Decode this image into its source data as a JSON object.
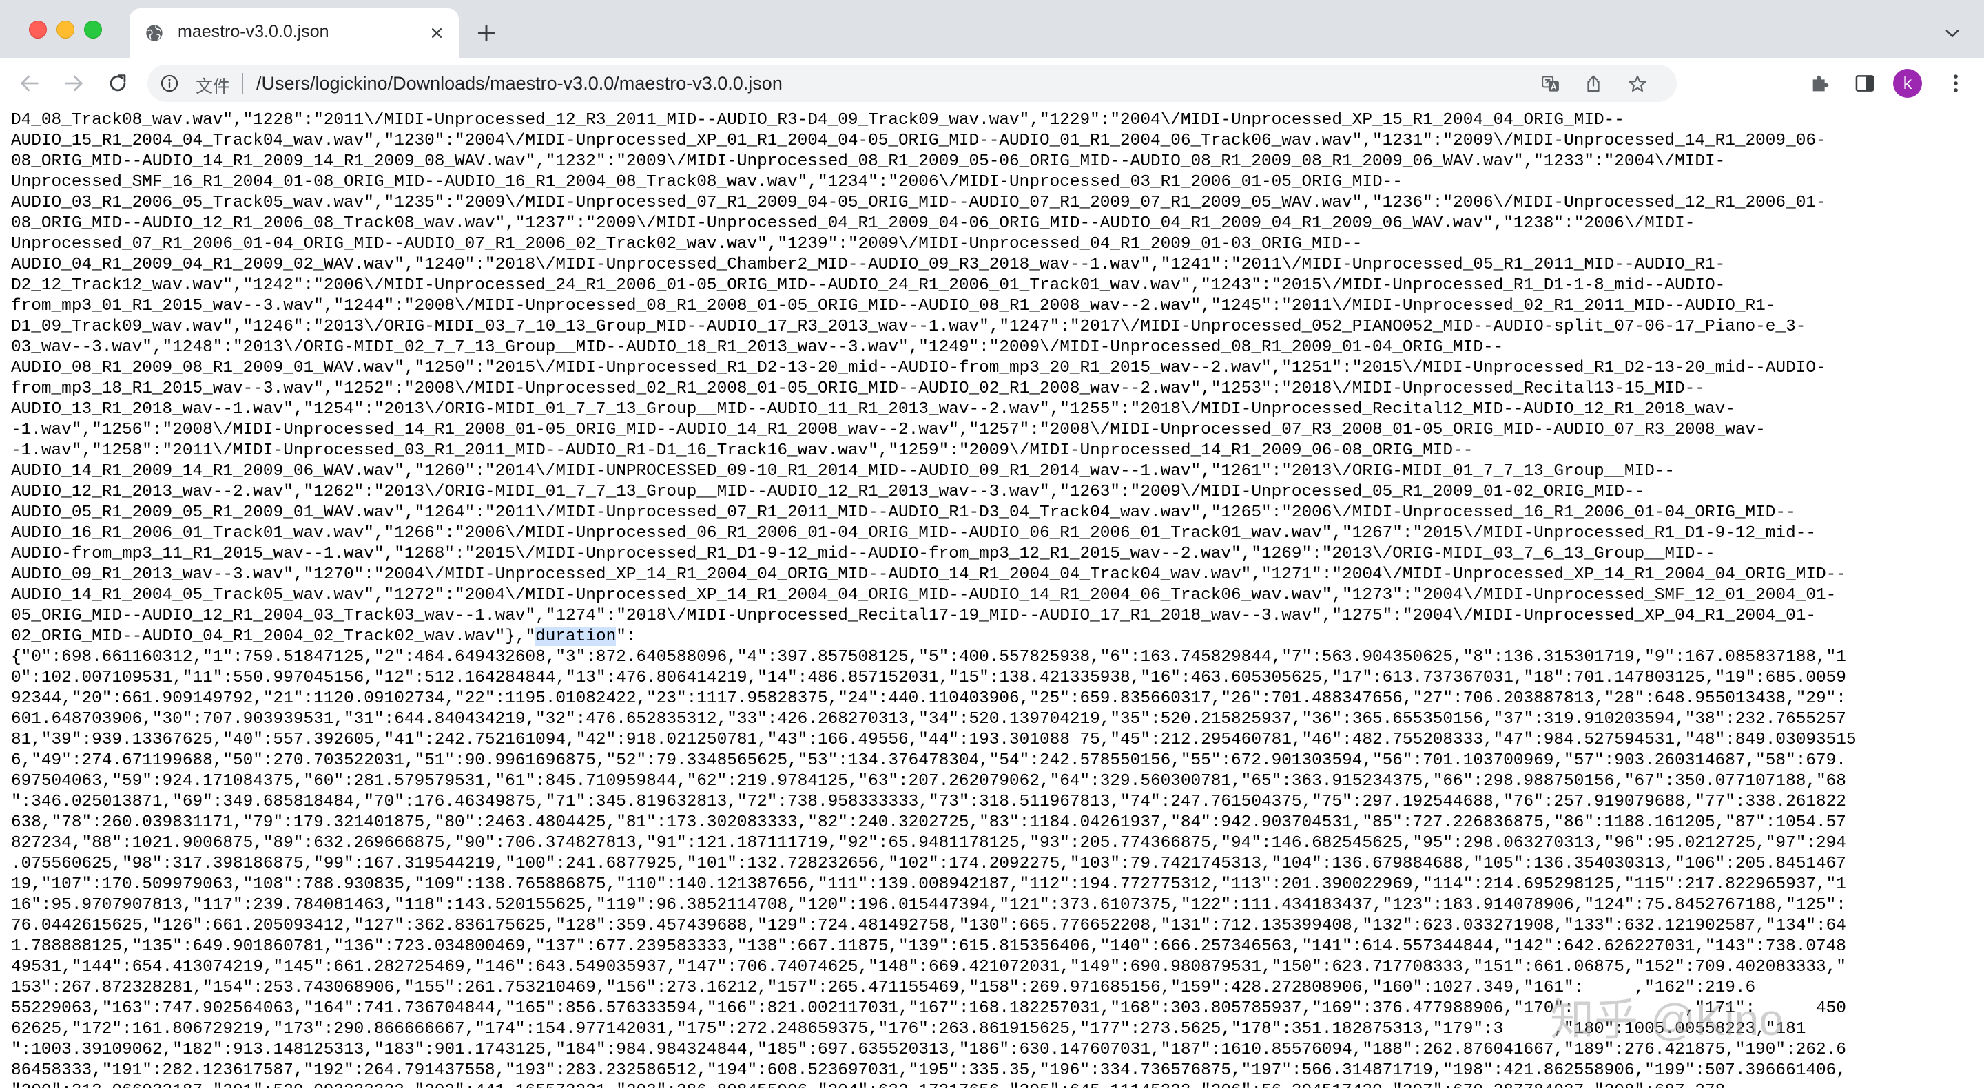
{
  "browser": {
    "tab": {
      "title": "maestro-v3.0.0.json",
      "favicon": "globe-icon"
    },
    "omnibox": {
      "scheme_label": "文件",
      "url": "/Users/logickino/Downloads/maestro-v3.0.0/maestro-v3.0.0.json"
    },
    "profile_initial": "k",
    "colors": {
      "titlebar": "#dee1e6",
      "omnibox": "#f1f3f4",
      "avatar": "#9c27b0",
      "highlight": "#cfe3fc"
    }
  },
  "content": {
    "lines_before": [
      "D4_08_Track08_wav.wav\",\"1228\":\"2011\\/MIDI-Unprocessed_12_R3_2011_MID--AUDIO_R3-D4_09_Track09_wav.wav\",\"1229\":\"2004\\/MIDI-Unprocessed_XP_15_R1_2004_04_ORIG_MID--",
      "AUDIO_15_R1_2004_04_Track04_wav.wav\",\"1230\":\"2004\\/MIDI-Unprocessed_XP_01_R1_2004_04-05_ORIG_MID--AUDIO_01_R1_2004_06_Track06_wav.wav\",\"1231\":\"2009\\/MIDI-Unprocessed_14_R1_2009_06-",
      "08_ORIG_MID--AUDIO_14_R1_2009_14_R1_2009_08_WAV.wav\",\"1232\":\"2009\\/MIDI-Unprocessed_08_R1_2009_05-06_ORIG_MID--AUDIO_08_R1_2009_08_R1_2009_06_WAV.wav\",\"1233\":\"2004\\/MIDI-",
      "Unprocessed_SMF_16_R1_2004_01-08_ORIG_MID--AUDIO_16_R1_2004_08_Track08_wav.wav\",\"1234\":\"2006\\/MIDI-Unprocessed_03_R1_2006_01-05_ORIG_MID--",
      "AUDIO_03_R1_2006_05_Track05_wav.wav\",\"1235\":\"2009\\/MIDI-Unprocessed_07_R1_2009_04-05_ORIG_MID--AUDIO_07_R1_2009_07_R1_2009_05_WAV.wav\",\"1236\":\"2006\\/MIDI-Unprocessed_12_R1_2006_01-",
      "08_ORIG_MID--AUDIO_12_R1_2006_08_Track08_wav.wav\",\"1237\":\"2009\\/MIDI-Unprocessed_04_R1_2009_04-06_ORIG_MID--AUDIO_04_R1_2009_04_R1_2009_06_WAV.wav\",\"1238\":\"2006\\/MIDI-",
      "Unprocessed_07_R1_2006_01-04_ORIG_MID--AUDIO_07_R1_2006_02_Track02_wav.wav\",\"1239\":\"2009\\/MIDI-Unprocessed_04_R1_2009_01-03_ORIG_MID--",
      "AUDIO_04_R1_2009_04_R1_2009_02_WAV.wav\",\"1240\":\"2018\\/MIDI-Unprocessed_Chamber2_MID--AUDIO_09_R3_2018_wav--1.wav\",\"1241\":\"2011\\/MIDI-Unprocessed_05_R1_2011_MID--AUDIO_R1-",
      "D2_12_Track12_wav.wav\",\"1242\":\"2006\\/MIDI-Unprocessed_24_R1_2006_01-05_ORIG_MID--AUDIO_24_R1_2006_01_Track01_wav.wav\",\"1243\":\"2015\\/MIDI-Unprocessed_R1_D1-1-8_mid--AUDIO-",
      "from_mp3_01_R1_2015_wav--3.wav\",\"1244\":\"2008\\/MIDI-Unprocessed_08_R1_2008_01-05_ORIG_MID--AUDIO_08_R1_2008_wav--2.wav\",\"1245\":\"2011\\/MIDI-Unprocessed_02_R1_2011_MID--AUDIO_R1-",
      "D1_09_Track09_wav.wav\",\"1246\":\"2013\\/ORIG-MIDI_03_7_10_13_Group_MID--AUDIO_17_R3_2013_wav--1.wav\",\"1247\":\"2017\\/MIDI-Unprocessed_052_PIANO052_MID--AUDIO-split_07-06-17_Piano-e_3-",
      "03_wav--3.wav\",\"1248\":\"2013\\/ORIG-MIDI_02_7_7_13_Group__MID--AUDIO_18_R1_2013_wav--3.wav\",\"1249\":\"2009\\/MIDI-Unprocessed_08_R1_2009_01-04_ORIG_MID--",
      "AUDIO_08_R1_2009_08_R1_2009_01_WAV.wav\",\"1250\":\"2015\\/MIDI-Unprocessed_R1_D2-13-20_mid--AUDIO-from_mp3_20_R1_2015_wav--2.wav\",\"1251\":\"2015\\/MIDI-Unprocessed_R1_D2-13-20_mid--AUDIO-",
      "from_mp3_18_R1_2015_wav--3.wav\",\"1252\":\"2008\\/MIDI-Unprocessed_02_R1_2008_01-05_ORIG_MID--AUDIO_02_R1_2008_wav--2.wav\",\"1253\":\"2018\\/MIDI-Unprocessed_Recital13-15_MID--",
      "AUDIO_13_R1_2018_wav--1.wav\",\"1254\":\"2013\\/ORIG-MIDI_01_7_7_13_Group__MID--AUDIO_11_R1_2013_wav--2.wav\",\"1255\":\"2018\\/MIDI-Unprocessed_Recital12_MID--AUDIO_12_R1_2018_wav-",
      "-1.wav\",\"1256\":\"2008\\/MIDI-Unprocessed_14_R1_2008_01-05_ORIG_MID--AUDIO_14_R1_2008_wav--2.wav\",\"1257\":\"2008\\/MIDI-Unprocessed_07_R3_2008_01-05_ORIG_MID--AUDIO_07_R3_2008_wav-",
      "-1.wav\",\"1258\":\"2011\\/MIDI-Unprocessed_03_R1_2011_MID--AUDIO_R1-D1_16_Track16_wav.wav\",\"1259\":\"2009\\/MIDI-Unprocessed_14_R1_2009_06-08_ORIG_MID--",
      "AUDIO_14_R1_2009_14_R1_2009_06_WAV.wav\",\"1260\":\"2014\\/MIDI-UNPROCESSED_09-10_R1_2014_MID--AUDIO_09_R1_2014_wav--1.wav\",\"1261\":\"2013\\/ORIG-MIDI_01_7_7_13_Group__MID--",
      "AUDIO_12_R1_2013_wav--2.wav\",\"1262\":\"2013\\/ORIG-MIDI_01_7_7_13_Group__MID--AUDIO_12_R1_2013_wav--3.wav\",\"1263\":\"2009\\/MIDI-Unprocessed_05_R1_2009_01-02_ORIG_MID--",
      "AUDIO_05_R1_2009_05_R1_2009_01_WAV.wav\",\"1264\":\"2011\\/MIDI-Unprocessed_07_R1_2011_MID--AUDIO_R1-D3_04_Track04_wav.wav\",\"1265\":\"2006\\/MIDI-Unprocessed_16_R1_2006_01-04_ORIG_MID--",
      "AUDIO_16_R1_2006_01_Track01_wav.wav\",\"1266\":\"2006\\/MIDI-Unprocessed_06_R1_2006_01-04_ORIG_MID--AUDIO_06_R1_2006_01_Track01_wav.wav\",\"1267\":\"2015\\/MIDI-Unprocessed_R1_D1-9-12_mid--",
      "AUDIO-from_mp3_11_R1_2015_wav--1.wav\",\"1268\":\"2015\\/MIDI-Unprocessed_R1_D1-9-12_mid--AUDIO-from_mp3_12_R1_2015_wav--2.wav\",\"1269\":\"2013\\/ORIG-MIDI_03_7_6_13_Group__MID--",
      "AUDIO_09_R1_2013_wav--3.wav\",\"1270\":\"2004\\/MIDI-Unprocessed_XP_14_R1_2004_04_ORIG_MID--AUDIO_14_R1_2004_04_Track04_wav.wav\",\"1271\":\"2004\\/MIDI-Unprocessed_XP_14_R1_2004_04_ORIG_MID--",
      "AUDIO_14_R1_2004_05_Track05_wav.wav\",\"1272\":\"2004\\/MIDI-Unprocessed_XP_14_R1_2004_04_ORIG_MID--AUDIO_14_R1_2004_06_Track06_wav.wav\",\"1273\":\"2004\\/MIDI-Unprocessed_SMF_12_01_2004_01-",
      "05_ORIG_MID--AUDIO_12_R1_2004_03_Track03_wav--1.wav\",\"1274\":\"2018\\/MIDI-Unprocessed_Recital17-19_MID--AUDIO_17_R1_2018_wav--3.wav\",\"1275\":\"2004\\/MIDI-Unprocessed_XP_04_R1_2004_01-",
      "02_ORIG_MID--AUDIO_04_R1_2004_02_Track02_wav.wav\"},\""
    ],
    "highlighted_word": "duration",
    "after_highlight": "\":",
    "lines_after": [
      "{\"0\":698.661160312,\"1\":759.51847125,\"2\":464.649432608,\"3\":872.640588096,\"4\":397.857508125,\"5\":400.557825938,\"6\":163.745829844,\"7\":563.904350625,\"8\":136.315301719,\"9\":167.085837188,\"1",
      "0\":102.007109531,\"11\":550.997045156,\"12\":512.164284844,\"13\":476.806414219,\"14\":486.857152031,\"15\":138.421335938,\"16\":463.605305625,\"17\":613.737367031,\"18\":701.147803125,\"19\":685.0059",
      "92344,\"20\":661.909149792,\"21\":1120.09102734,\"22\":1195.01082422,\"23\":1117.95828375,\"24\":440.110403906,\"25\":659.835660317,\"26\":701.488347656,\"27\":706.203887813,\"28\":648.955013438,\"29\":",
      "601.648703906,\"30\":707.903939531,\"31\":644.840434219,\"32\":476.652835312,\"33\":426.268270313,\"34\":520.139704219,\"35\":520.215825937,\"36\":365.655350156,\"37\":319.910203594,\"38\":232.7655257",
      "81,\"39\":939.13367625,\"40\":557.392605,\"41\":242.752161094,\"42\":918.021250781,\"43\":166.49556,\"44\":193.301088 75,\"45\":212.295460781,\"46\":482.755208333,\"47\":984.527594531,\"48\":849.03093515",
      "6,\"49\":274.671199688,\"50\":270.703522031,\"51\":90.9961696875,\"52\":79.3348565625,\"53\":134.376478304,\"54\":242.578550156,\"55\":672.901303594,\"56\":701.103700969,\"57\":903.260314687,\"58\":679.",
      "697504063,\"59\":924.171084375,\"60\":281.579579531,\"61\":845.710959844,\"62\":219.9784125,\"63\":207.262079062,\"64\":329.560300781,\"65\":363.915234375,\"66\":298.988750156,\"67\":350.077107188,\"68",
      "\":346.025013871,\"69\":349.685818484,\"70\":176.46349875,\"71\":345.819632813,\"72\":738.958333333,\"73\":318.511967813,\"74\":247.761504375,\"75\":297.192544688,\"76\":257.919079688,\"77\":338.261822",
      "638,\"78\":260.039831171,\"79\":179.321401875,\"80\":2463.4804425,\"81\":173.302083333,\"82\":240.3202725,\"83\":1184.04261937,\"84\":942.903704531,\"85\":727.226836875,\"86\":1188.161205,\"87\":1054.57",
      "827234,\"88\":1021.9006875,\"89\":632.269666875,\"90\":706.374827813,\"91\":121.187111719,\"92\":65.9481178125,\"93\":205.774366875,\"94\":146.682545625,\"95\":298.063270313,\"96\":95.0212725,\"97\":294",
      ".075560625,\"98\":317.398186875,\"99\":167.319544219,\"100\":241.6877925,\"101\":132.728232656,\"102\":174.2092275,\"103\":79.7421745313,\"104\":136.679884688,\"105\":136.354030313,\"106\":205.8451467",
      "19,\"107\":170.509979063,\"108\":788.930835,\"109\":138.765886875,\"110\":140.121387656,\"111\":139.008942187,\"112\":194.772775312,\"113\":201.390022969,\"114\":214.695298125,\"115\":217.822965937,\"1",
      "16\":95.9707907813,\"117\":239.784081463,\"118\":143.520155625,\"119\":96.3852114708,\"120\":196.015447394,\"121\":373.6107375,\"122\":111.434183437,\"123\":183.914078906,\"124\":75.8452767188,\"125\":",
      "76.0442615625,\"126\":661.205093412,\"127\":362.836175625,\"128\":359.457439688,\"129\":724.481492758,\"130\":665.776652208,\"131\":712.135399408,\"132\":623.033271908,\"133\":632.121902587,\"134\":64",
      "1.788888125,\"135\":649.901860781,\"136\":723.034800469,\"137\":677.239583333,\"138\":667.11875,\"139\":615.815356406,\"140\":666.257346563,\"141\":614.557344844,\"142\":642.626227031,\"143\":738.0748",
      "49531,\"144\":654.413074219,\"145\":661.282725469,\"146\":643.549035937,\"147\":706.74074625,\"148\":669.421072031,\"149\":690.980879531,\"150\":623.717708333,\"151\":661.06875,\"152\":709.402083333,\"",
      "153\":267.872328281,\"154\":253.743068906,\"155\":261.753210469,\"156\":273.16212,\"157\":265.471155469,\"158\":269.971685156,\"159\":428.272808906,\"160\":1027.349,\"161\":     ,\"162\":219.6",
      "55229063,\"163\":747.902564063,\"164\":741.736704844,\"165\":856.576333594,\"166\":821.002117031,\"167\":168.182257031,\"168\":303.805785937,\"169\":376.477988906,\"170\":           ,\"171\":      450",
      "62625,\"172\":161.806729219,\"173\":290.866666667,\"174\":154.977142031,\"175\":272.248659375,\"176\":263.861915625,\"177\":273.5625,\"178\":351.182875313,\"179\":3     ,\"180\":1005.00558223,\"181",
      "\":1003.39109062,\"182\":913.148125313,\"183\":901.1743125,\"184\":984.984324844,\"185\":697.635520313,\"186\":630.147607031,\"187\":1610.85576094,\"188\":262.876041667,\"189\":276.421875,\"190\":262.6",
      "86458333,\"191\":282.123617587,\"192\":264.791437558,\"193\":283.232586512,\"194\":608.523697031,\"195\":335.35,\"196\":334.736576875,\"197\":566.314871719,\"198\":421.862558906,\"199\":507.396661406,",
      "\"200\":313.066032187,\"201\":529.093333333,\"202\":441.165573221,\"203\":386.808455906,\"204\":632.17317656,\"205\":645.11145323,\"206\":56.304517420,\"207\":670.287784937,\"208\":687.378"
    ]
  },
  "watermark": "知乎 @Kino"
}
